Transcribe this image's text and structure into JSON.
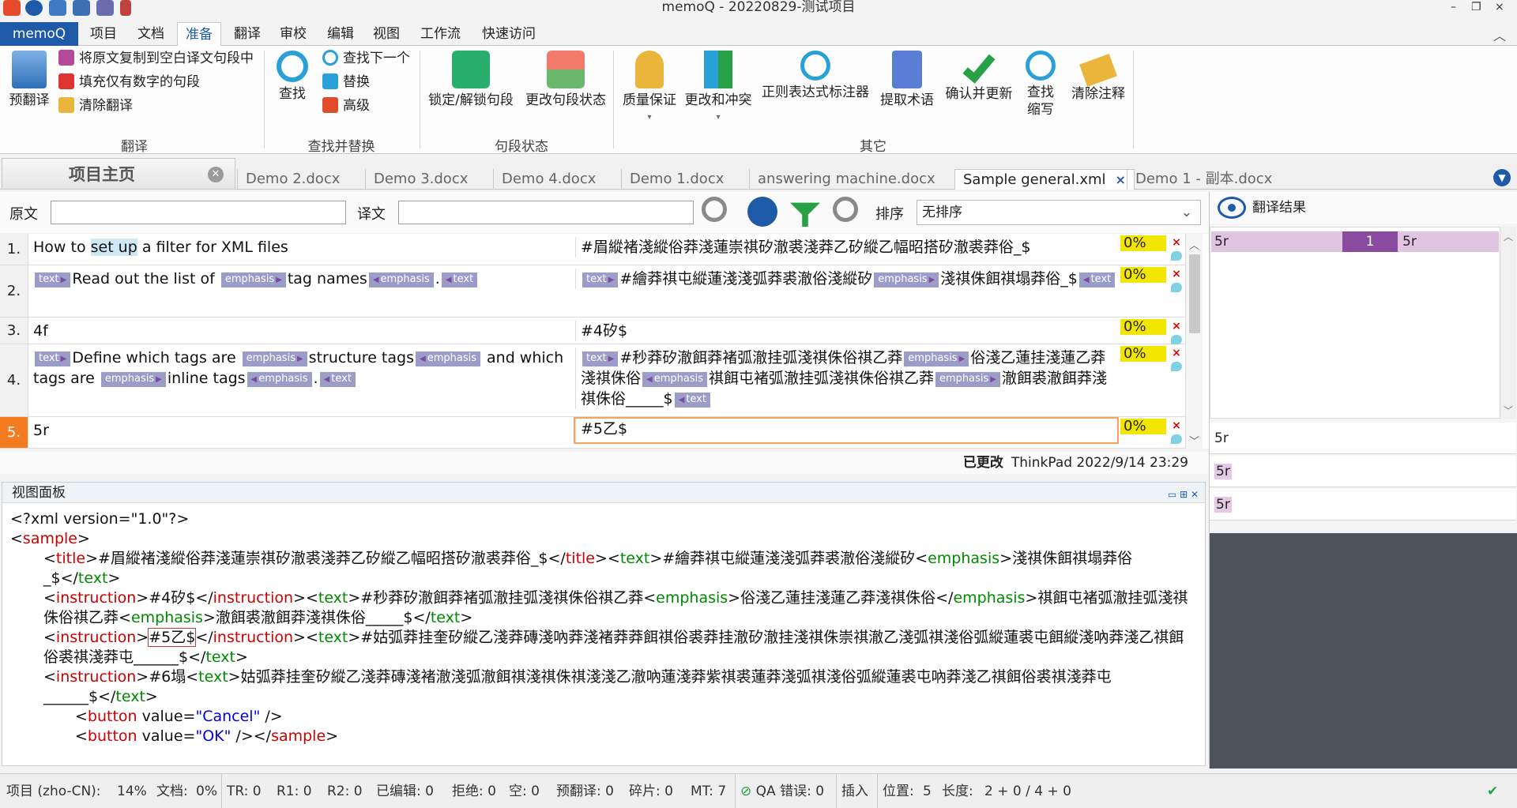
{
  "window": {
    "title": "memoQ - 20220829-测试项目",
    "minimize": "–",
    "restore": "❐",
    "close": "×"
  },
  "menu": {
    "app": "memoQ",
    "tabs": [
      "项目",
      "文档",
      "准备",
      "翻译",
      "审校",
      "编辑",
      "视图",
      "工作流",
      "快速访问"
    ],
    "active": "准备"
  },
  "ribbon": {
    "translate_group": {
      "label": "翻译",
      "pretranslate": "预翻译",
      "copy_source": "将原文复制到空白译文句段中",
      "fill_numbers": "填充仅有数字的句段",
      "clear": "清除翻译"
    },
    "find_group": {
      "label": "查找并替换",
      "find": "查找",
      "find_next": "查找下一个",
      "replace": "替换",
      "advanced": "高级"
    },
    "segment_group": {
      "label": "句段状态",
      "lock": "锁定/解锁句段",
      "change_status": "更改句段状态"
    },
    "other_group": {
      "label": "其它",
      "qa": "质量保证",
      "changes": "更改和冲突",
      "regex": "正则表达式标注器",
      "extract_terms": "提取术语",
      "confirm_update": "确认并更新",
      "find_abbr_1": "查找",
      "find_abbr_2": "缩写",
      "clear_comments": "清除注释"
    },
    "colors": {
      "blue": "#1e5aa8",
      "green": "#27a046",
      "orange": "#f47b20",
      "yellow": "#e9b53b"
    }
  },
  "doctabs": {
    "home": "项目主页",
    "tabs": [
      "Demo 2.docx",
      "Demo 3.docx",
      "Demo 4.docx",
      "Demo 1.docx",
      "answering machine.docx",
      "Sample general.xml",
      "Demo 1 - 副本.docx"
    ],
    "active": "Sample general.xml"
  },
  "filter": {
    "source_label": "原文",
    "source_value": "",
    "target_label": "译文",
    "target_value": "",
    "sort_label": "排序",
    "sort_value": "无排序"
  },
  "rows": [
    {
      "num": "1.",
      "src_a": "How to ",
      "src_hl": "set up",
      "src_b": " a filter for XML files",
      "tgt": "#眉縱褚淺縱俗莽淺蓮崇祺矽澈裘淺莽乙矽縱乙幅昭搭矽澈裘莽俗_$",
      "pct": "0%"
    },
    {
      "num": "2.",
      "src_t1": "text",
      "src_a": "Read out the list of ",
      "src_t2": "emphasis",
      "src_b": "tag names",
      "src_t3": "emphasis",
      "src_c": ".",
      "src_t4": "text",
      "tgt_t1": "text",
      "tgt_a": "#繪莽祺屯縱蓮淺淺弧莽裘澈俗淺縱矽",
      "tgt_t2": "emphasis",
      "tgt_b": "淺祺侏餌祺塌莽俗_$",
      "tgt_t3": "text",
      "pct": "0%"
    },
    {
      "num": "3.",
      "src_a": "4f",
      "tgt": "#4矽$",
      "pct": "0%"
    },
    {
      "num": "4.",
      "src_t1": "text",
      "src_a": "Define which tags are ",
      "src_t2": "emphasis",
      "src_b": "structure tags",
      "src_t3": "emphasis",
      "src_c": " and which tags are ",
      "src_t4": "emphasis",
      "src_d": "inline tags",
      "src_t5": "emphasis",
      "src_e": ".",
      "src_t6": "text",
      "tgt_t1": "text",
      "tgt_a": "#秒莽矽澈餌莽褚弧澈挂弧淺祺侏俗祺乙莽",
      "tgt_t2": "emphasis",
      "tgt_b": "俗淺乙蓮挂淺蓮乙莽淺祺侏俗",
      "tgt_t3": "emphasis",
      "tgt_c": "祺餌屯褚弧澈挂弧淺祺侏俗祺乙莽",
      "tgt_t4": "emphasis",
      "tgt_d": "澈餌裘澈餌莽淺祺侏俗_____$",
      "tgt_t5": "text",
      "pct": "0%"
    },
    {
      "num": "5.",
      "src_a": "5r",
      "tgt": "#5乙$",
      "pct": "0%"
    }
  ],
  "row_status": {
    "reject": "×"
  },
  "changed": {
    "label": "已更改",
    "info": "ThinkPad 2022/9/14 23:29"
  },
  "viewpane": {
    "title": "视图面板",
    "decl": "<?xml version=\"1.0\"?>",
    "root": "sample",
    "title_tag": "title",
    "title_text": "#眉縱褚淺縱俗莽淺蓮崇祺矽澈裘淺莽乙矽縱乙幅昭搭矽澈裘莽俗_$",
    "text_tag": "text",
    "line1_text": "#繪莽祺屯縱蓮淺淺弧莽裘澈俗淺縱矽",
    "emph_tag": "emphasis",
    "line1_emph": "淺祺侏餌祺塌莽俗",
    "line1_tail": "_$",
    "instr_tag": "instruction",
    "instr2": "#4矽$",
    "line2_text": "#秒莽矽澈餌莽褚弧澈挂弧淺祺侏俗祺乙莽",
    "line2_emph": "俗淺乙蓮挂淺蓮乙莽淺祺侏俗",
    "line2_mid": "祺餌屯褚弧澈挂弧淺祺侏俗祺乙莽",
    "line2_emph2": "澈餌裘澈餌莽淺祺侏俗",
    "line2_tail": "_____$",
    "instr3": "#5乙$",
    "line3_text": "#姑弧莽挂奎矽縱乙淺莽磚淺吶莽淺褚莽莽餌祺俗裘莽挂澈矽澈挂淺祺侏崇祺澈乙淺弧祺淺俗弧縱蓮裘屯餌縱淺吶莽淺乙祺餌俗裘祺淺莽屯",
    "line3_tail": "______$",
    "instr4": "#6塌",
    "line4_text": "姑弧莽挂奎矽縱乙淺莽磚淺褚澈淺弧澈餌祺淺祺侏祺淺淺乙澈吶蓮淺莽紫祺裘蓮莽淺弧祺淺俗弧縱蓮裘屯吶莽淺乙祺餌俗裘祺淺莽屯",
    "line4_tail": "______$",
    "button_tag": "button",
    "value_attr": "value",
    "btn1": "\"Cancel\"",
    "btn2": "\"OK\""
  },
  "rightpanel": {
    "title": "翻译结果",
    "result_src": "5r",
    "result_num": "1",
    "result_tgt": "5r",
    "lines": [
      "5r",
      "5r",
      "5r"
    ]
  },
  "statusbar": {
    "project": "项目 (zho-CN):",
    "project_pct": "14%",
    "doc": "文档:",
    "doc_pct": "0%",
    "tr": "TR: 0",
    "r1": "R1: 0",
    "r2": "R2: 0",
    "edited": "已编辑: 0",
    "rejected": "拒绝: 0",
    "empty": "空: 0",
    "pretrans": "预翻译: 0",
    "fragments": "碎片: 0",
    "mt": "MT: 7",
    "qa": "QA 错误:",
    "qa_count": "0",
    "insert": "插入",
    "position": "位置:",
    "position_val": "5",
    "length": "长度:",
    "length_val": "2 + 0 / 4 + 0",
    "ok_mark": "✔"
  }
}
